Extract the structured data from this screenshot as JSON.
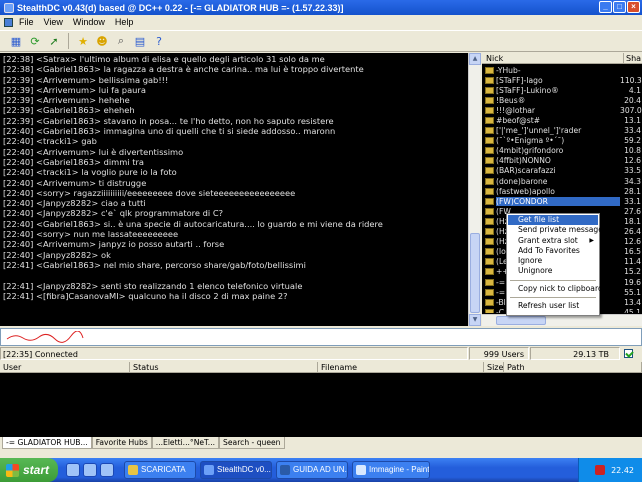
{
  "window": {
    "title": "StealthDC v0.43(d) based @ DC++  0.22 - [-= GLADIATOR HUB =- (1.57.22.33)]"
  },
  "menu": [
    "File",
    "View",
    "Window",
    "Help"
  ],
  "toolbar_icons": [
    "hub-connect-icon",
    "reconnect-icon",
    "follow-icon",
    "favorites-icon",
    "users-icon",
    "search-icon",
    "spy-icon",
    "help-icon"
  ],
  "chat": [
    "[22:38] <Satrax> l'ultimo album di elisa e quello degli articolo 31 solo da me",
    "[22:38] <Gabriel1863> la ragazza a destra è anche carina.. ma lui è troppo divertente",
    "[22:39] <Arrivemum> bellissima gab!!!",
    "[22:39] <Arrivemum> lui fa paura",
    "[22:39] <Arrivemum> hehehe",
    "[22:39] <Gabriel1863> eheheh",
    "[22:39] <Gabriel1863> stavano in posa... te l'ho detto, non ho saputo resistere",
    "[22:40] <Gabriel1863> immagina uno di quelli che ti si siede addosso.. maronn",
    "[22:40] <tracki1> gab",
    "[22:40] <Arrivemum> lui è divertentissimo",
    "[22:40] <Gabriel1863> dimmi tra",
    "[22:40] <tracki1> la voglio pure io la foto",
    "[22:40] <Arrivemum> ti distrugge",
    "[22:40] <sorry> ragazziiiiiiiiii/eeeeeeeee dove sieteeeeeeeeeeeeeeee",
    "[22:40] <Janpyz8282> ciao a tutti",
    "[22:40] <Janpyz8282> c'e` qlk programmatore di C?",
    "[22:40] <Gabriel1863> si.. è una specie di autocaricatura.... lo guardo e mi viene da ridere",
    "[22:40] <sorry> nun me lassateeeeeeeee",
    "[22:40] <Arrivemum> janpyz io posso autarti .. forse",
    "[22:40] <Janpyz8282> ok",
    "[22:41] <Gabriel1863> nel mio share, percorso share/gab/foto/bellissimi",
    "",
    "[22:41] <Janpyz8282> senti sto realizzando 1 elenco telefonico virtuale",
    "[22:41] <[fibra]CasanovaMI> qualcuno ha il disco 2 di max paine 2?"
  ],
  "users": {
    "col_nick": "Nick",
    "col_share": "Sha",
    "rows": [
      {
        "nick": "-YHub-",
        "share": ""
      },
      {
        "nick": "[STaFF]-Iago",
        "share": "110.3"
      },
      {
        "nick": "[STaFF]-Lukino®",
        "share": "4.1"
      },
      {
        "nick": "!Beus®",
        "share": "20.4"
      },
      {
        "nick": "!!!@lothar",
        "share": "307.0"
      },
      {
        "nick": "#beof@st#",
        "share": "13.1"
      },
      {
        "nick": "['|'me_']'unnel_']'rader",
        "share": "33.4"
      },
      {
        "nick": "(¯`º•Enigma º•´¯)",
        "share": "59.2"
      },
      {
        "nick": "(4mbit)grifondoro",
        "share": "10.8"
      },
      {
        "nick": "(4ffbit)NONNO",
        "share": "12.6"
      },
      {
        "nick": "(BAR)scarafazzi",
        "share": "33.5"
      },
      {
        "nick": "(done)barone",
        "share": "34.3"
      },
      {
        "nick": "(fastweb)apollo",
        "share": "28.1"
      },
      {
        "nick": "(FW)CONDOR",
        "share": "33.1"
      },
      {
        "nick": "(FW",
        "share": "27.6"
      },
      {
        "nick": "(Hz",
        "share": "18.1"
      },
      {
        "nick": "(Hz",
        "share": "26.4"
      },
      {
        "nick": "(Hz",
        "share": "12.6"
      },
      {
        "nick": "(lo",
        "share": "16.5"
      },
      {
        "nick": "(Le",
        "share": "11.4"
      },
      {
        "nick": "++",
        "share": "15.2"
      },
      {
        "nick": "-=",
        "share": "19.6"
      },
      {
        "nick": "-=",
        "share": "55.1"
      },
      {
        "nick": "-Bl",
        "share": "13.4"
      },
      {
        "nick": "-C",
        "share": "45.1"
      }
    ],
    "selected": "(FW)CONDOR"
  },
  "context_menu": {
    "items": [
      "Get file list",
      "Send private message",
      "Grant extra slot",
      "Add To Favorites",
      "Ignore",
      "Unignore",
      "Copy nick to clipboard",
      "Refresh user list"
    ],
    "highlighted": "Get file list"
  },
  "status": {
    "time_text": "[22:35] Connected",
    "users": "999 Users",
    "share": "29.13 TB"
  },
  "transfers": {
    "cols": [
      "User",
      "Status",
      "Filename",
      "Size",
      "Path"
    ]
  },
  "tabs": [
    "-= GLADIATOR HUB...",
    "Favorite Hubs",
    "...Eletti...°NeT...",
    "Search - queen"
  ],
  "taskbar": {
    "start": "start",
    "buttons": [
      {
        "label": "SCARICATA",
        "color": "#e8c545"
      },
      {
        "label": "StealthDC v0....",
        "color": "#6ca0f8"
      },
      {
        "label": "GUIDA AD UN...",
        "color": "#2a5ba8"
      },
      {
        "label": "Immagine - Paint",
        "color": "#d8e8ff"
      }
    ],
    "clock": "22.42"
  }
}
